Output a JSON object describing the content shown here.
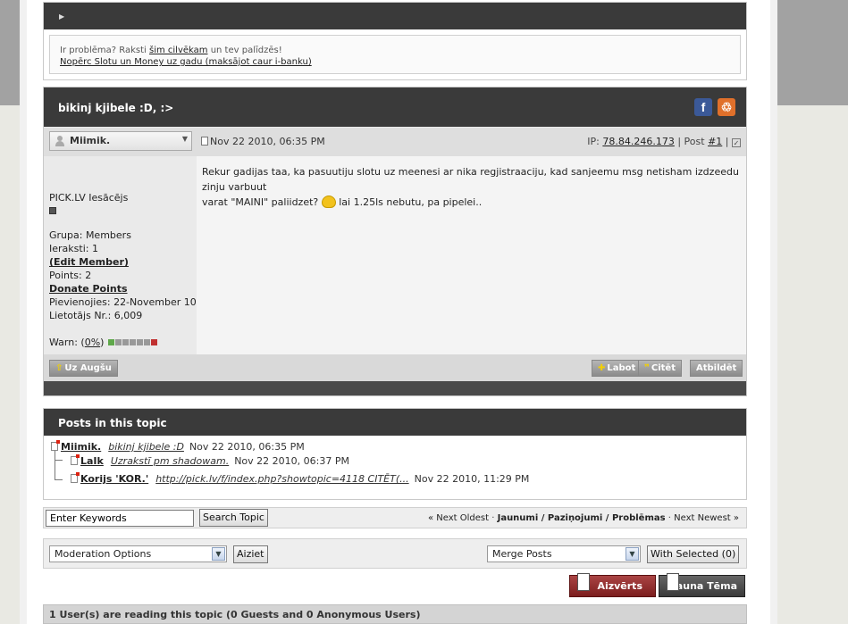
{
  "help_box": {
    "line1_prefix": "Ir problēma? Raksti",
    "line1_link": "šim cilvēkam",
    "line1_suffix": "un tev palīdzēs!",
    "line2_link": "Nopērc Slotu un Money uz gadu (maksājot caur i-banku)"
  },
  "post": {
    "title": "bikinj kjibele :D, :>",
    "author": "Miimik.",
    "date": "Nov 22 2010, 06:35 PM",
    "ip_label": "IP:",
    "ip": "78.84.246.173",
    "post_label": "| Post",
    "post_number": "#1",
    "body_line1": "Rekur gadijas taa, ka pasuutiju slotu uz meenesi ar nika regjistraaciju, kad sanjeemu msg netisham izdzeedu zinju varbuut",
    "body_line2a": "varat \"MAINI\" paliidzet?",
    "body_line2b": "lai 1.25ls nebutu, pa pipelei.."
  },
  "user_info": {
    "rank": "PICK.LV Iesācējs",
    "group": "Grupa: Members",
    "posts": "Ieraksti: 1",
    "edit_member": "(Edit Member)",
    "points": "Points: 2",
    "donate_points": "Donate Points",
    "joined": "Pievienojies: 22-November 10",
    "user_nr": "Lietotājs Nr.: 6,009",
    "warn_label": "Warn:",
    "warn_value": "0%"
  },
  "post_buttons": {
    "top": "Uz Augšu",
    "edit": "Labot",
    "quote": "Citēt",
    "reply": "Atbildēt"
  },
  "topic_posts": {
    "heading": "Posts in this topic",
    "items": [
      {
        "name": "Miimik.",
        "title": "bikinj kjibele :D",
        "date": "Nov 22 2010, 06:35 PM"
      },
      {
        "name": "LaIk",
        "title": "Uzrakstī pm shadowam.",
        "date": "Nov 22 2010, 06:37 PM"
      },
      {
        "name": "Korijs 'KOR.'",
        "title": "http://pick.lv/f/index.php?showtopic=4118 CITĒT(...",
        "date": "Nov 22 2010, 11:29 PM"
      }
    ]
  },
  "search": {
    "placeholder": "Enter Keywords",
    "button": "Search Topic",
    "nav_next_oldest": "« Next Oldest",
    "nav_sep": "·",
    "nav_forum": "Jaunumi / Paziņojumi / Problēmas",
    "nav_next_newest": "Next Newest »"
  },
  "moderation": {
    "options_label": "Moderation Options",
    "go_button": "Aiziet",
    "merge_label": "Merge Posts",
    "with_selected": "With Selected (0)"
  },
  "bottom_buttons": {
    "close": "Aizvērts",
    "new_topic": "Jauna Tēma"
  },
  "readers": "1 User(s) are reading this topic (0 Guests and 0 Anonymous Users)",
  "colors": {
    "dark_bar": "#3a3a3a",
    "close_red": "#8b2a2a",
    "gray_button": "#8b8b8b"
  }
}
